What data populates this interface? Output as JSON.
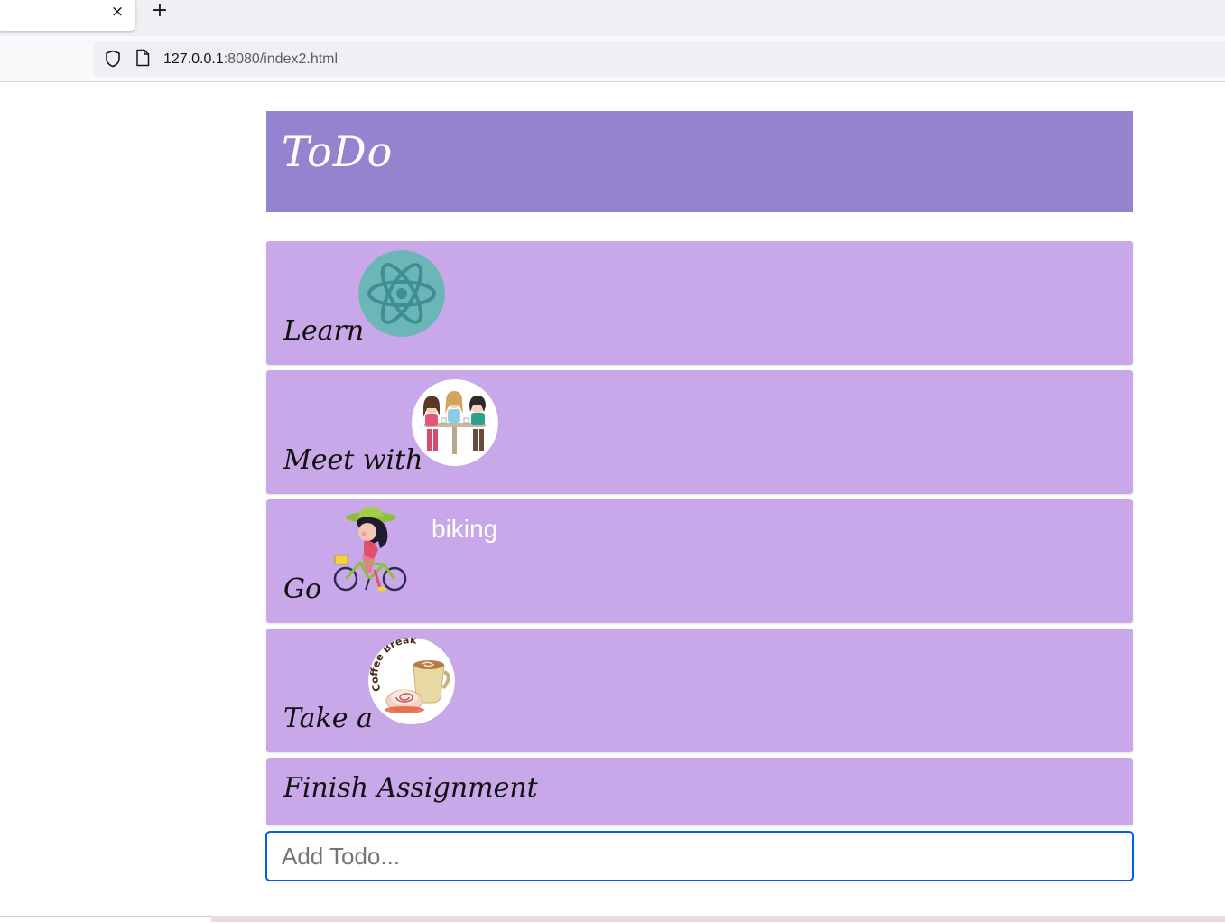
{
  "browser": {
    "tab_close_glyph": "×",
    "new_tab_glyph": "+",
    "url_host": "127.0.0.1",
    "url_rest": ":8080/index2.html"
  },
  "app": {
    "title": "ToDo",
    "colors": {
      "header": "#9484cf",
      "item": "#c8a8e9",
      "input_border": "#0060df"
    },
    "todos": [
      {
        "text": "Learn",
        "image": "react-logo-icon"
      },
      {
        "text": "Meet with",
        "image": "friends-illustration"
      },
      {
        "text": "Go",
        "image": "biking-girl-illustration",
        "note": "biking"
      },
      {
        "text": "Take a",
        "image": "coffee-break-illustration",
        "image_text": "Coffee Break"
      },
      {
        "text": "Finish Assignment"
      }
    ],
    "input": {
      "placeholder": "Add Todo...",
      "value": ""
    }
  }
}
